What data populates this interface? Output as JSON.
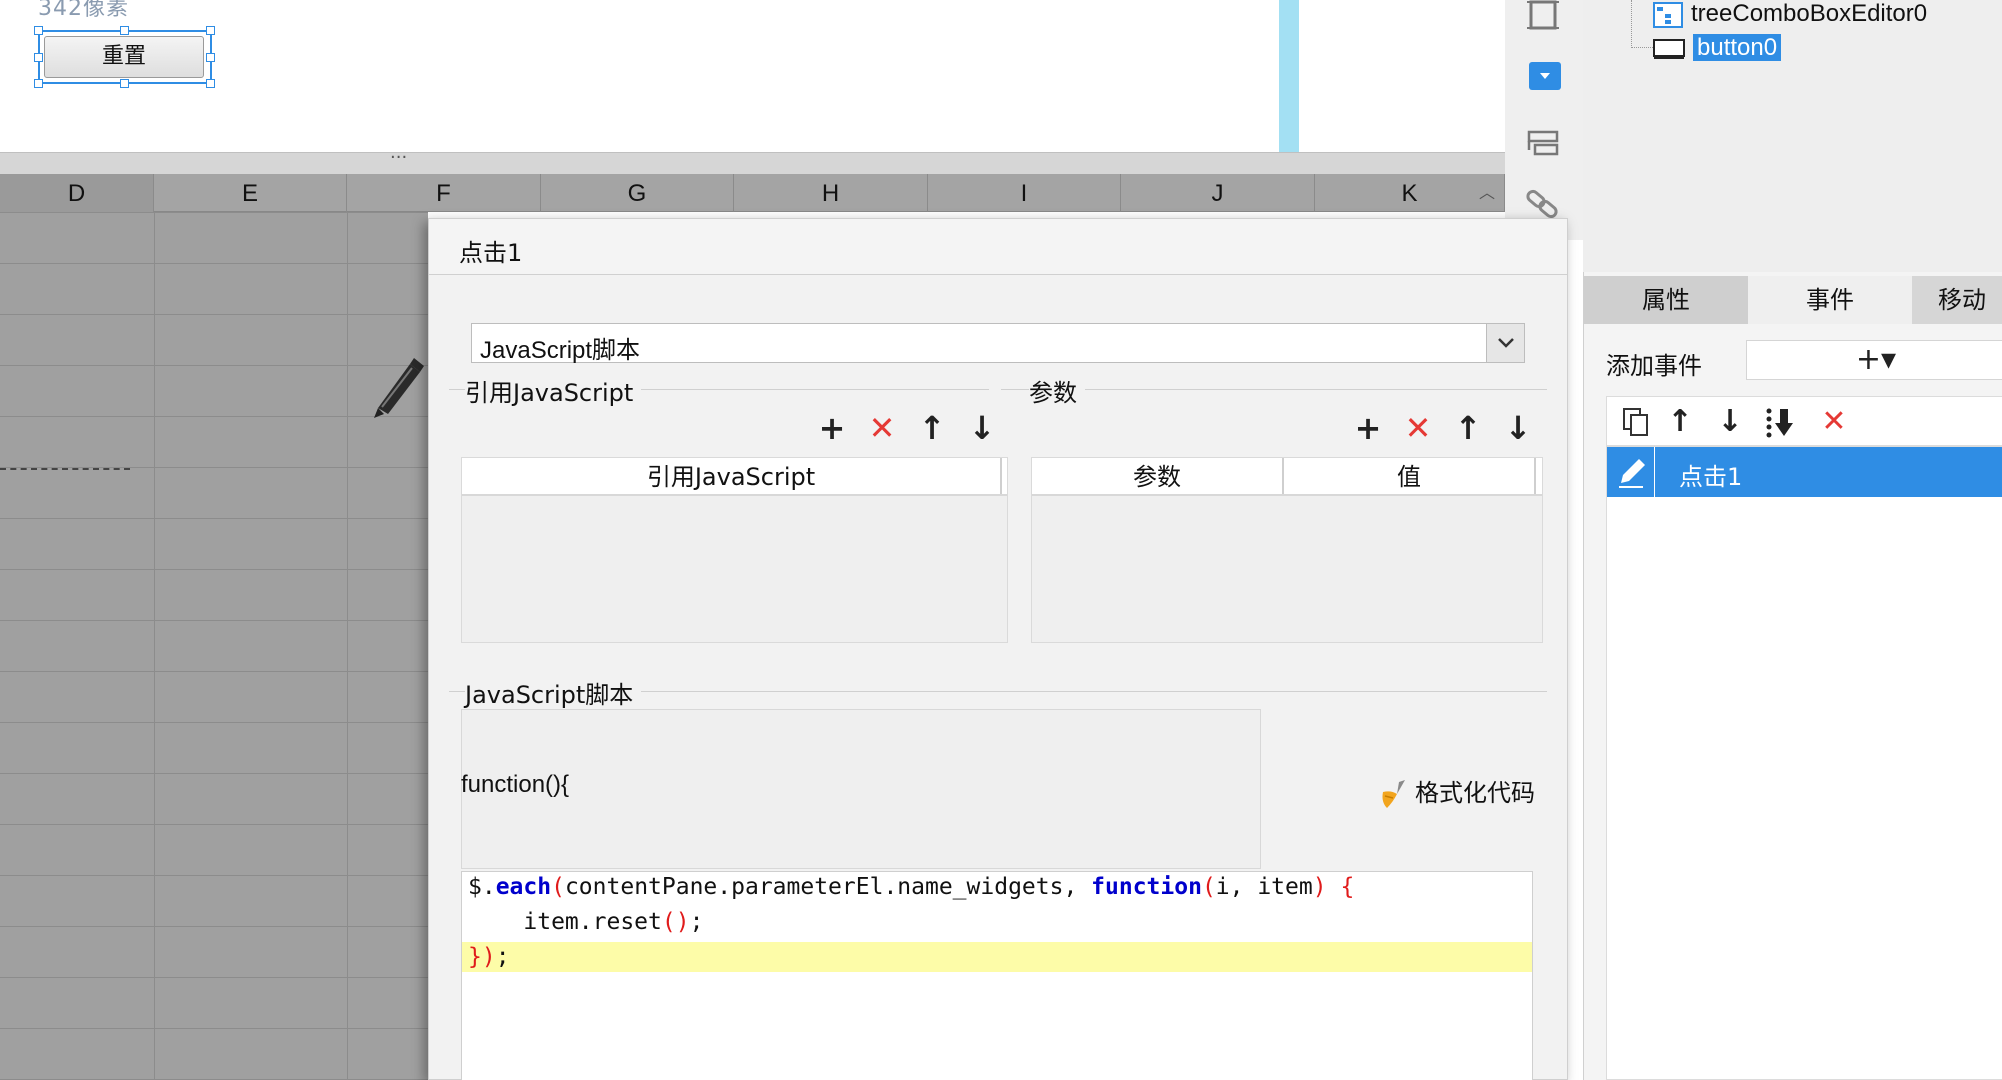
{
  "canvas": {
    "hint_text": "342像素",
    "reset_widget_label": "重置"
  },
  "spreadsheet": {
    "columns": [
      "D",
      "E",
      "F",
      "G",
      "H",
      "I",
      "J",
      "K"
    ]
  },
  "tree": {
    "items": [
      {
        "label": "treeComboBoxEditor0",
        "icon": "tree-combo-icon"
      },
      {
        "label": "button0",
        "icon": "button-widget-icon",
        "selected": true
      }
    ]
  },
  "properties_panel": {
    "tabs": [
      "属性",
      "事件",
      "移动"
    ],
    "active_tab": "事件",
    "add_event_label": "添加事件",
    "add_event_button": "+▾",
    "events": [
      {
        "label": "点击1",
        "selected": true
      }
    ]
  },
  "dialog": {
    "title": "点击1",
    "type_select_value": "JavaScript脚本",
    "ref_js_section": "引用JavaScript",
    "ref_js_column": "引用JavaScript",
    "params_section": "参数",
    "params_columns": [
      "参数",
      "值"
    ],
    "script_section": "JavaScript脚本",
    "function_open": "function(){",
    "format_button": "格式化代码",
    "code_lines": [
      "$.each(contentPane.parameterEl.name_widgets, function(i, item) {",
      "    item.reset();",
      "});"
    ]
  },
  "colors": {
    "accent": "#2f8de4",
    "delete": "#e53935",
    "highlight_line": "#fdfca8",
    "keyword": "#0000cc"
  }
}
